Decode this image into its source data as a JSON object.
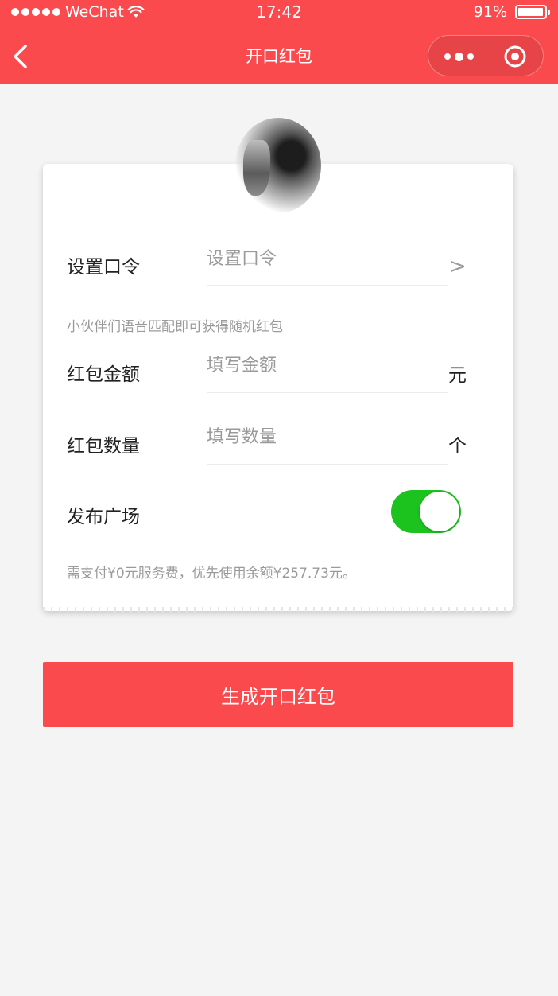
{
  "status_bar": {
    "carrier": "WeChat",
    "time": "17:42",
    "battery_percent": "91%",
    "battery_level": 0.91,
    "signal_icon": "signal-dots-icon",
    "wifi_icon": "wifi-icon"
  },
  "nav": {
    "title": "开口红包",
    "back_icon": "chevron-left-icon",
    "more_icon": "more-dots-icon",
    "close_icon": "target-circle-icon"
  },
  "form": {
    "password": {
      "label": "设置口令",
      "placeholder": "设置口令",
      "value": "",
      "arrow": ">"
    },
    "password_hint": "小伙伴们语音匹配即可获得随机红包",
    "amount": {
      "label": "红包金额",
      "placeholder": "填写金额",
      "value": "",
      "suffix": "元"
    },
    "count": {
      "label": "红包数量",
      "placeholder": "填写数量",
      "value": "",
      "suffix": "个"
    },
    "publish": {
      "label": "发布广场",
      "enabled": true
    },
    "fee_note": "需支付¥0元服务费，优先使用余额¥257.73元。"
  },
  "submit_label": "生成开口红包",
  "colors": {
    "brand_red": "#fb4a4e",
    "toggle_green": "#1cc31e",
    "background": "#f4f4f4",
    "hint_gray": "#9a9a9a"
  }
}
